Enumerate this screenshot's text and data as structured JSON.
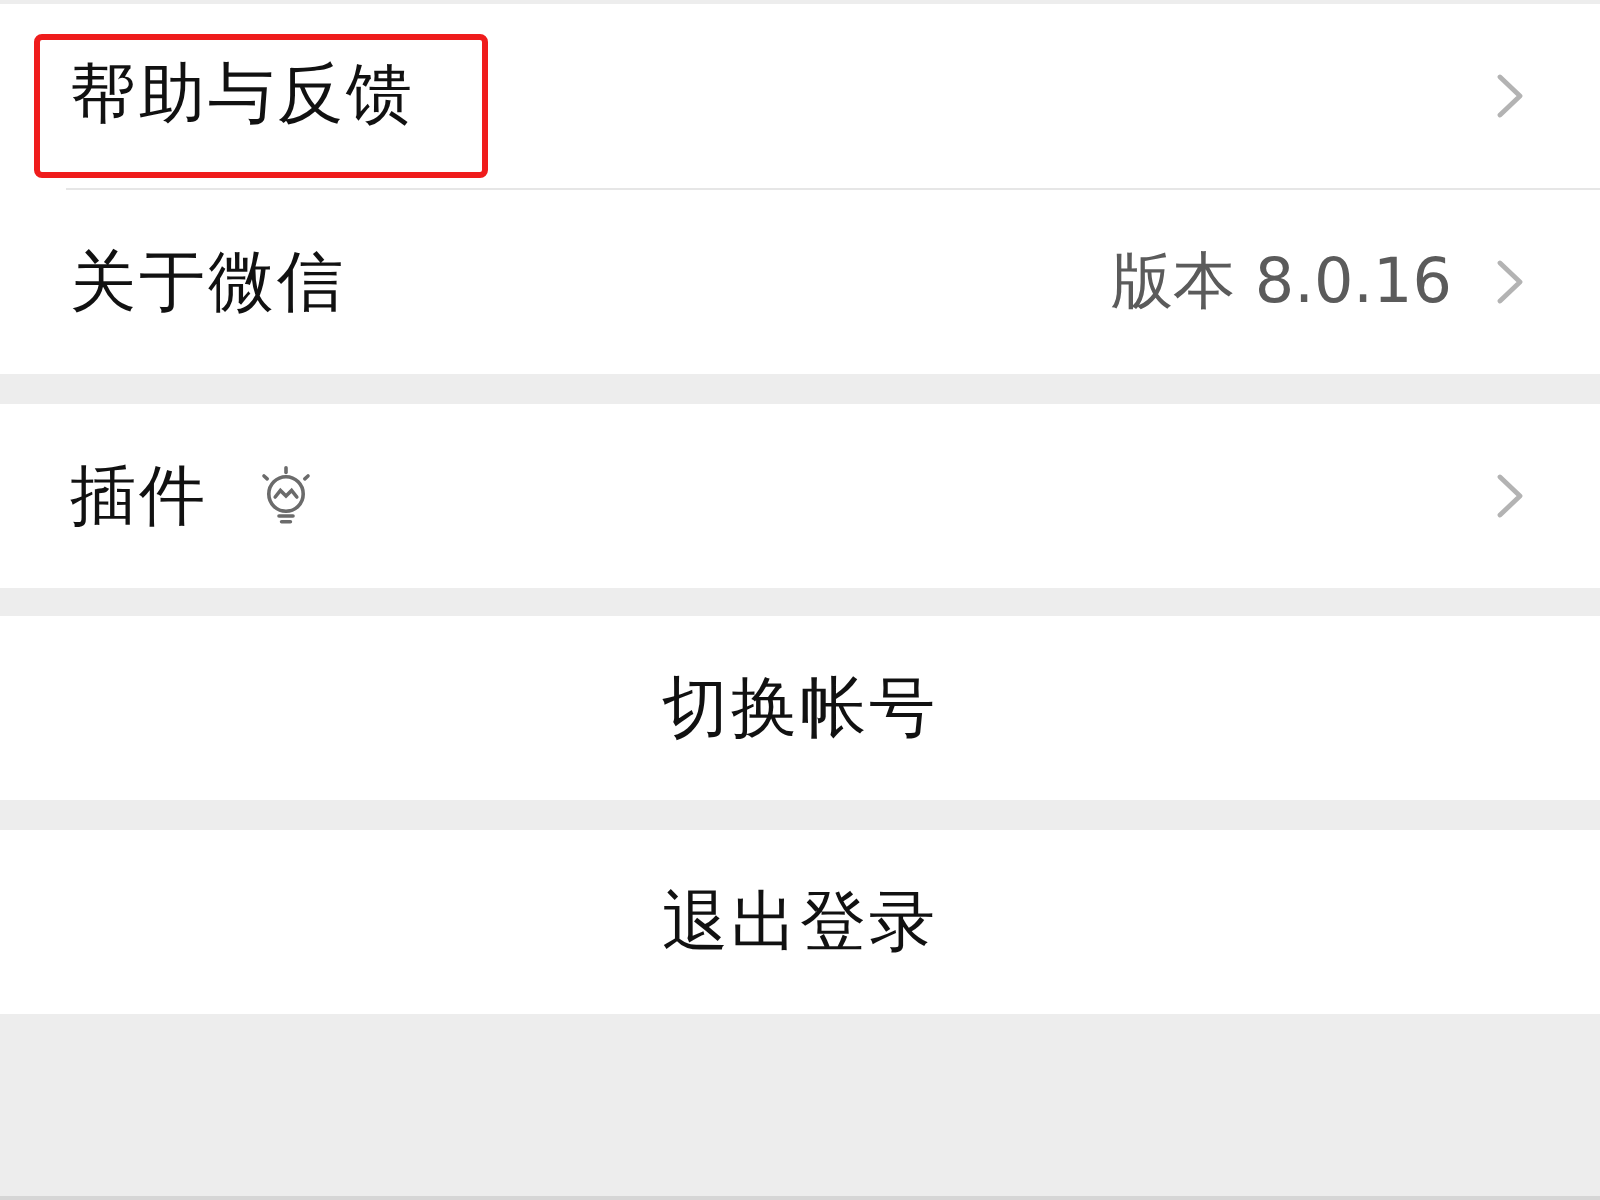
{
  "groups": [
    {
      "items": [
        {
          "kind": "link",
          "label": "帮助与反馈",
          "highlighted": true,
          "icon": false
        },
        {
          "kind": "link",
          "label": "关于微信",
          "value": "版本 8.0.16",
          "highlighted": false,
          "icon": false
        }
      ]
    },
    {
      "items": [
        {
          "kind": "link",
          "label": "插件",
          "highlighted": false,
          "icon": true
        }
      ]
    },
    {
      "items": [
        {
          "kind": "action",
          "label": "切换帐号",
          "highlighted": false,
          "icon": false
        }
      ]
    },
    {
      "items": [
        {
          "kind": "action",
          "label": "退出登录",
          "highlighted": false,
          "icon": false
        }
      ]
    }
  ]
}
